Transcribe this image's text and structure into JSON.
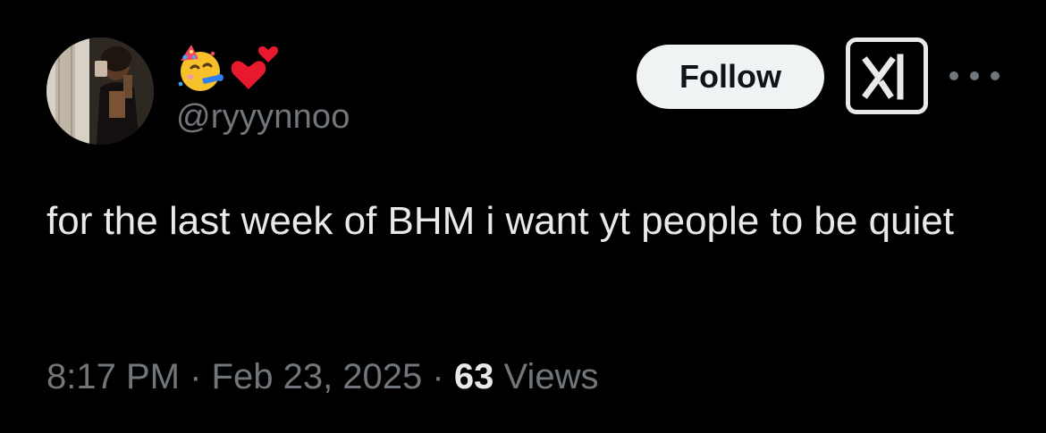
{
  "author": {
    "display_name_emojis": [
      "partying-face-emoji",
      "two-hearts-emoji"
    ],
    "handle": "@ryyynnoo",
    "avatar": "profile-photo"
  },
  "actions": {
    "follow_label": "Follow",
    "grok_icon": "grok-icon",
    "more_icon": "more-options-icon"
  },
  "tweet": {
    "text": "for the last week of BHM i want yt people to be quiet"
  },
  "meta": {
    "time": "8:17 PM",
    "separator": "·",
    "date": "Feb 23, 2025",
    "views_count": "63",
    "views_label": "Views"
  },
  "colors": {
    "background": "#000000",
    "primary_text": "#e7e9ea",
    "secondary_text": "#71767b",
    "follow_bg": "#eff3f4",
    "follow_text": "#0f1419"
  }
}
